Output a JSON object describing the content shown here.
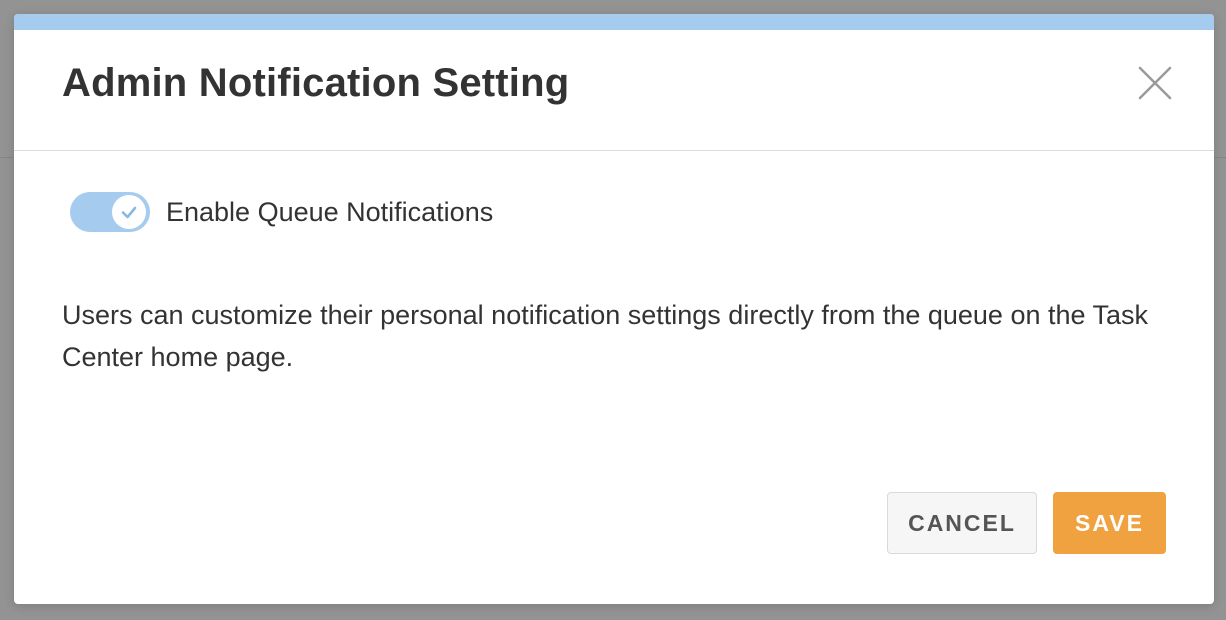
{
  "dialog": {
    "title": "Admin Notification Setting",
    "close_icon": "close-icon",
    "accent_color": "#a5cbee",
    "toggle": {
      "label": "Enable Queue Notifications",
      "enabled": true,
      "icon": "check-icon"
    },
    "description": "Users can customize their personal notification settings directly from the queue on the Task Center home page.",
    "buttons": {
      "cancel_label": "CANCEL",
      "save_label": "SAVE",
      "save_color": "#f0a140"
    }
  }
}
